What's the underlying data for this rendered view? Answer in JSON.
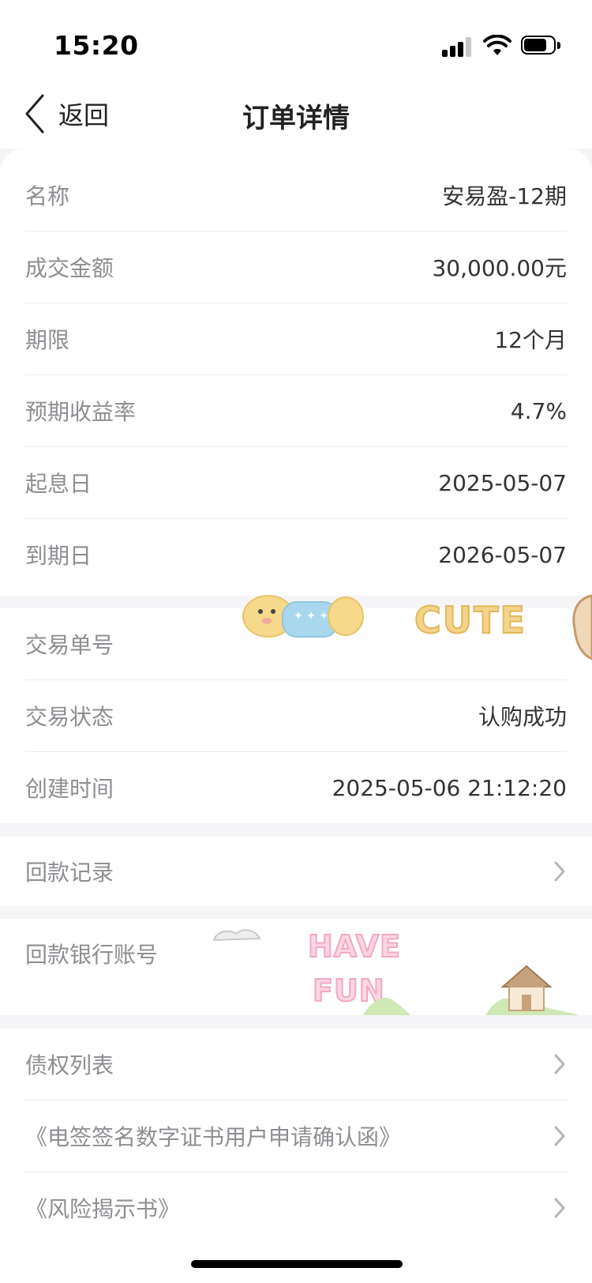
{
  "status_bar": {
    "time": "15:20"
  },
  "nav": {
    "back_label": "返回",
    "title": "订单详情"
  },
  "order_info": [
    {
      "label": "名称",
      "value": "安易盈-12期"
    },
    {
      "label": "成交金额",
      "value": "30,000.00元"
    },
    {
      "label": "期限",
      "value": "12个月"
    },
    {
      "label": "预期收益率",
      "value": "4.7%"
    },
    {
      "label": "起息日",
      "value": "2025-05-07"
    },
    {
      "label": "到期日",
      "value": "2026-05-07"
    }
  ],
  "trade_info": [
    {
      "label": "交易单号",
      "value": ""
    },
    {
      "label": "交易状态",
      "value": "认购成功"
    },
    {
      "label": "创建时间",
      "value": "2025-05-06 21:12:20"
    }
  ],
  "repayment_record": {
    "label": "回款记录"
  },
  "repayment_bank": {
    "label": "回款银行账号"
  },
  "documents": [
    {
      "label": "债权列表"
    },
    {
      "label": "《电签签名数字证书用户申请确认函》"
    },
    {
      "label": "《风险揭示书》"
    }
  ],
  "stickers": {
    "cute": "CUTE",
    "have": "HAVE",
    "fun": "FUN"
  },
  "colors": {
    "label_gray": "#8e8e93",
    "divider": "#ececec",
    "background": "#f5f5f7"
  }
}
